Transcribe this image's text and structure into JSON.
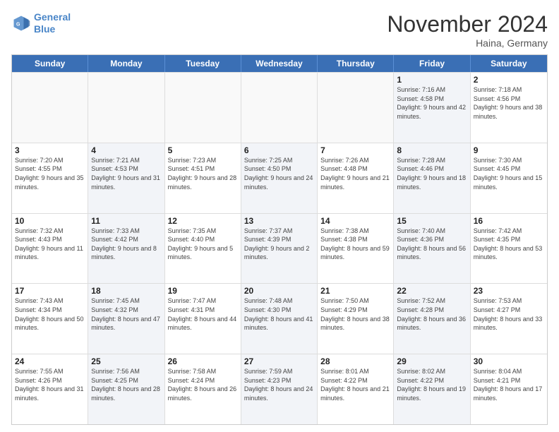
{
  "logo": {
    "line1": "General",
    "line2": "Blue"
  },
  "title": "November 2024",
  "location": "Haina, Germany",
  "header_days": [
    "Sunday",
    "Monday",
    "Tuesday",
    "Wednesday",
    "Thursday",
    "Friday",
    "Saturday"
  ],
  "weeks": [
    [
      {
        "day": "",
        "sunrise": "",
        "sunset": "",
        "daylight": "",
        "shade": false
      },
      {
        "day": "",
        "sunrise": "",
        "sunset": "",
        "daylight": "",
        "shade": false
      },
      {
        "day": "",
        "sunrise": "",
        "sunset": "",
        "daylight": "",
        "shade": false
      },
      {
        "day": "",
        "sunrise": "",
        "sunset": "",
        "daylight": "",
        "shade": false
      },
      {
        "day": "",
        "sunrise": "",
        "sunset": "",
        "daylight": "",
        "shade": false
      },
      {
        "day": "1",
        "sunrise": "Sunrise: 7:16 AM",
        "sunset": "Sunset: 4:58 PM",
        "daylight": "Daylight: 9 hours and 42 minutes.",
        "shade": true
      },
      {
        "day": "2",
        "sunrise": "Sunrise: 7:18 AM",
        "sunset": "Sunset: 4:56 PM",
        "daylight": "Daylight: 9 hours and 38 minutes.",
        "shade": false
      }
    ],
    [
      {
        "day": "3",
        "sunrise": "Sunrise: 7:20 AM",
        "sunset": "Sunset: 4:55 PM",
        "daylight": "Daylight: 9 hours and 35 minutes.",
        "shade": false
      },
      {
        "day": "4",
        "sunrise": "Sunrise: 7:21 AM",
        "sunset": "Sunset: 4:53 PM",
        "daylight": "Daylight: 9 hours and 31 minutes.",
        "shade": true
      },
      {
        "day": "5",
        "sunrise": "Sunrise: 7:23 AM",
        "sunset": "Sunset: 4:51 PM",
        "daylight": "Daylight: 9 hours and 28 minutes.",
        "shade": false
      },
      {
        "day": "6",
        "sunrise": "Sunrise: 7:25 AM",
        "sunset": "Sunset: 4:50 PM",
        "daylight": "Daylight: 9 hours and 24 minutes.",
        "shade": true
      },
      {
        "day": "7",
        "sunrise": "Sunrise: 7:26 AM",
        "sunset": "Sunset: 4:48 PM",
        "daylight": "Daylight: 9 hours and 21 minutes.",
        "shade": false
      },
      {
        "day": "8",
        "sunrise": "Sunrise: 7:28 AM",
        "sunset": "Sunset: 4:46 PM",
        "daylight": "Daylight: 9 hours and 18 minutes.",
        "shade": true
      },
      {
        "day": "9",
        "sunrise": "Sunrise: 7:30 AM",
        "sunset": "Sunset: 4:45 PM",
        "daylight": "Daylight: 9 hours and 15 minutes.",
        "shade": false
      }
    ],
    [
      {
        "day": "10",
        "sunrise": "Sunrise: 7:32 AM",
        "sunset": "Sunset: 4:43 PM",
        "daylight": "Daylight: 9 hours and 11 minutes.",
        "shade": false
      },
      {
        "day": "11",
        "sunrise": "Sunrise: 7:33 AM",
        "sunset": "Sunset: 4:42 PM",
        "daylight": "Daylight: 9 hours and 8 minutes.",
        "shade": true
      },
      {
        "day": "12",
        "sunrise": "Sunrise: 7:35 AM",
        "sunset": "Sunset: 4:40 PM",
        "daylight": "Daylight: 9 hours and 5 minutes.",
        "shade": false
      },
      {
        "day": "13",
        "sunrise": "Sunrise: 7:37 AM",
        "sunset": "Sunset: 4:39 PM",
        "daylight": "Daylight: 9 hours and 2 minutes.",
        "shade": true
      },
      {
        "day": "14",
        "sunrise": "Sunrise: 7:38 AM",
        "sunset": "Sunset: 4:38 PM",
        "daylight": "Daylight: 8 hours and 59 minutes.",
        "shade": false
      },
      {
        "day": "15",
        "sunrise": "Sunrise: 7:40 AM",
        "sunset": "Sunset: 4:36 PM",
        "daylight": "Daylight: 8 hours and 56 minutes.",
        "shade": true
      },
      {
        "day": "16",
        "sunrise": "Sunrise: 7:42 AM",
        "sunset": "Sunset: 4:35 PM",
        "daylight": "Daylight: 8 hours and 53 minutes.",
        "shade": false
      }
    ],
    [
      {
        "day": "17",
        "sunrise": "Sunrise: 7:43 AM",
        "sunset": "Sunset: 4:34 PM",
        "daylight": "Daylight: 8 hours and 50 minutes.",
        "shade": false
      },
      {
        "day": "18",
        "sunrise": "Sunrise: 7:45 AM",
        "sunset": "Sunset: 4:32 PM",
        "daylight": "Daylight: 8 hours and 47 minutes.",
        "shade": true
      },
      {
        "day": "19",
        "sunrise": "Sunrise: 7:47 AM",
        "sunset": "Sunset: 4:31 PM",
        "daylight": "Daylight: 8 hours and 44 minutes.",
        "shade": false
      },
      {
        "day": "20",
        "sunrise": "Sunrise: 7:48 AM",
        "sunset": "Sunset: 4:30 PM",
        "daylight": "Daylight: 8 hours and 41 minutes.",
        "shade": true
      },
      {
        "day": "21",
        "sunrise": "Sunrise: 7:50 AM",
        "sunset": "Sunset: 4:29 PM",
        "daylight": "Daylight: 8 hours and 38 minutes.",
        "shade": false
      },
      {
        "day": "22",
        "sunrise": "Sunrise: 7:52 AM",
        "sunset": "Sunset: 4:28 PM",
        "daylight": "Daylight: 8 hours and 36 minutes.",
        "shade": true
      },
      {
        "day": "23",
        "sunrise": "Sunrise: 7:53 AM",
        "sunset": "Sunset: 4:27 PM",
        "daylight": "Daylight: 8 hours and 33 minutes.",
        "shade": false
      }
    ],
    [
      {
        "day": "24",
        "sunrise": "Sunrise: 7:55 AM",
        "sunset": "Sunset: 4:26 PM",
        "daylight": "Daylight: 8 hours and 31 minutes.",
        "shade": false
      },
      {
        "day": "25",
        "sunrise": "Sunrise: 7:56 AM",
        "sunset": "Sunset: 4:25 PM",
        "daylight": "Daylight: 8 hours and 28 minutes.",
        "shade": true
      },
      {
        "day": "26",
        "sunrise": "Sunrise: 7:58 AM",
        "sunset": "Sunset: 4:24 PM",
        "daylight": "Daylight: 8 hours and 26 minutes.",
        "shade": false
      },
      {
        "day": "27",
        "sunrise": "Sunrise: 7:59 AM",
        "sunset": "Sunset: 4:23 PM",
        "daylight": "Daylight: 8 hours and 24 minutes.",
        "shade": true
      },
      {
        "day": "28",
        "sunrise": "Sunrise: 8:01 AM",
        "sunset": "Sunset: 4:22 PM",
        "daylight": "Daylight: 8 hours and 21 minutes.",
        "shade": false
      },
      {
        "day": "29",
        "sunrise": "Sunrise: 8:02 AM",
        "sunset": "Sunset: 4:22 PM",
        "daylight": "Daylight: 8 hours and 19 minutes.",
        "shade": true
      },
      {
        "day": "30",
        "sunrise": "Sunrise: 8:04 AM",
        "sunset": "Sunset: 4:21 PM",
        "daylight": "Daylight: 8 hours and 17 minutes.",
        "shade": false
      }
    ]
  ]
}
